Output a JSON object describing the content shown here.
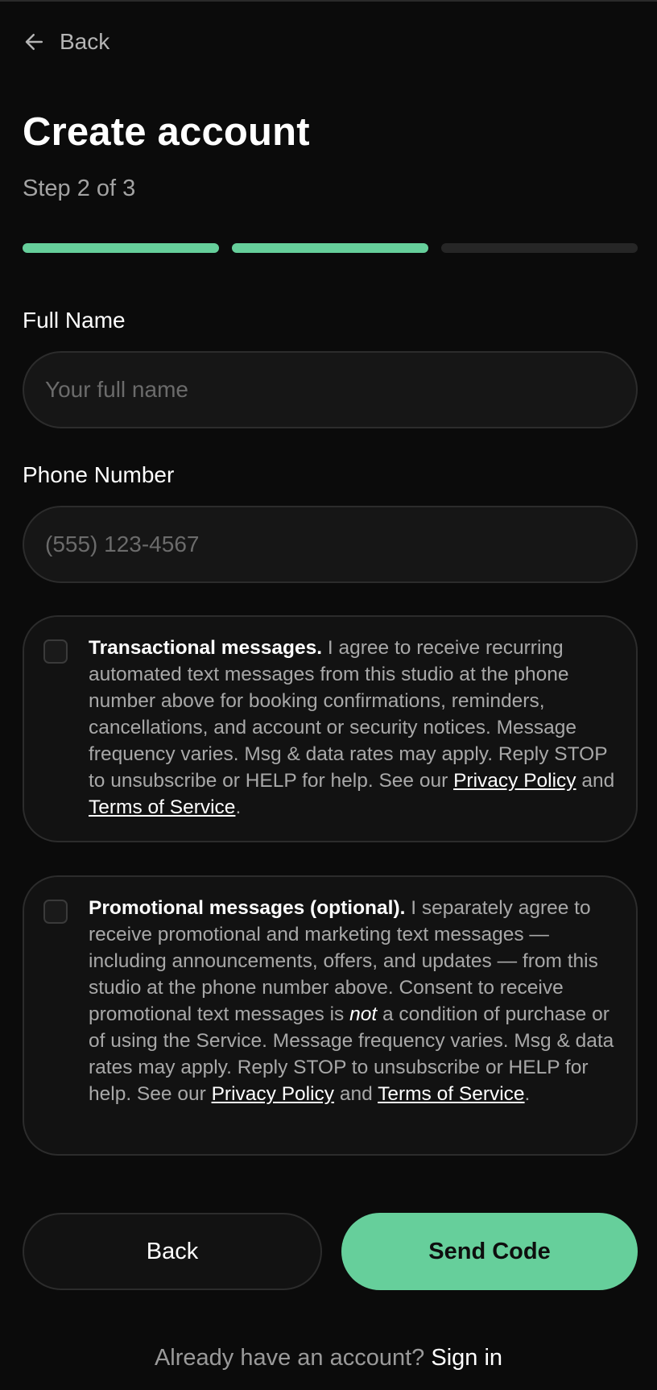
{
  "header": {
    "back_label": "Back"
  },
  "page": {
    "title": "Create account",
    "step_text": "Step 2 of 3"
  },
  "progress": {
    "current_step": 2,
    "total_steps": 3,
    "accent_color": "#66cf9b"
  },
  "form": {
    "full_name": {
      "label": "Full Name",
      "placeholder": "Your full name",
      "value": ""
    },
    "phone": {
      "label": "Phone Number",
      "placeholder": "(555) 123-4567",
      "value": ""
    }
  },
  "consent": {
    "transactional": {
      "checked": false,
      "lead": "Transactional messages.",
      "body": " I agree to receive recurring automated text messages from this studio at the phone number above for booking confirmations, reminders, cancellations, and account or security notices. Message frequency varies. Msg & data rates may apply. Reply STOP to unsubscribe or HELP for help. See our ",
      "privacy_link": "Privacy Policy",
      "and": " and ",
      "terms_link": "Terms of Service",
      "end": "."
    },
    "promotional": {
      "checked": false,
      "lead": "Promotional messages (optional).",
      "body_a": " I separately agree to receive promotional and marketing text messages — including announcements, offers, and updates — from this studio at the phone number above. Consent to receive promotional text messages is ",
      "emphasis": "not",
      "body_b": " a condition of purchase or of using the Service. Message frequency varies. Msg & data rates may apply. Reply STOP to unsubscribe or HELP for help. See our ",
      "privacy_link": "Privacy Policy",
      "and": " and ",
      "terms_link": "Terms of Service",
      "end": "."
    }
  },
  "actions": {
    "back_label": "Back",
    "send_label": "Send Code"
  },
  "footer": {
    "prompt": "Already have an account? ",
    "sign_in_label": "Sign in"
  }
}
